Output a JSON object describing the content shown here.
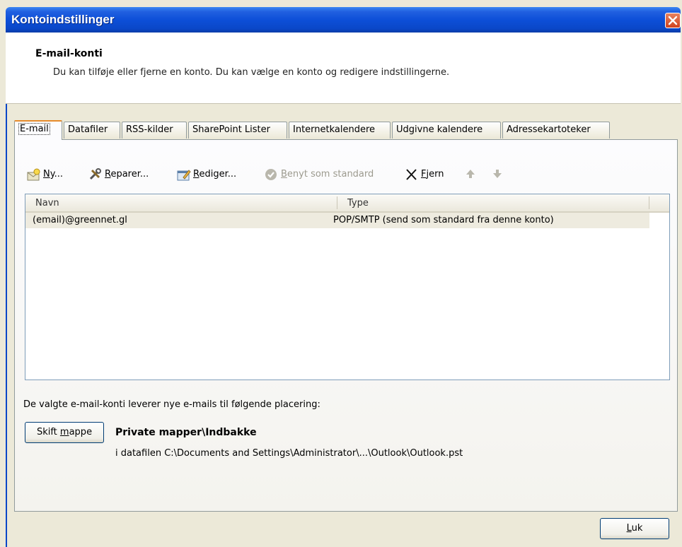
{
  "window": {
    "title": "Kontoindstillinger",
    "accent_color": "#0a47c8"
  },
  "header": {
    "title": "E-mail-konti",
    "subtitle": "Du kan tilføje eller fjerne en konto. Du kan vælge en konto og redigere indstillingerne."
  },
  "tabs": [
    {
      "label": "E-mail",
      "active": true
    },
    {
      "label": "Datafiler"
    },
    {
      "label": "RSS-kilder"
    },
    {
      "label": "SharePoint Lister"
    },
    {
      "label": "Internetkalendere"
    },
    {
      "label": "Udgivne kalendere"
    },
    {
      "label": "Adressekartoteker"
    }
  ],
  "toolbar": {
    "new": {
      "prefix": "",
      "key": "N",
      "rest": "y...",
      "icon": "new-account-icon"
    },
    "repair": {
      "prefix": "",
      "key": "R",
      "rest": "eparer...",
      "icon": "repair-tools-icon"
    },
    "edit": {
      "prefix": "",
      "key": "R",
      "rest": "ediger...",
      "icon": "edit-account-icon"
    },
    "set_default": {
      "prefix": "",
      "key": "B",
      "rest": "enyt som standard",
      "icon": "checkmark-icon",
      "disabled": true
    },
    "remove": {
      "prefix": "",
      "key": "F",
      "rest": "jern",
      "icon": "close-x-icon"
    },
    "move_up_icon": "arrow-up-icon",
    "move_down_icon": "arrow-down-icon"
  },
  "account_list": {
    "columns": [
      "Navn",
      "Type"
    ],
    "rows": [
      {
        "name": "(email)@greennet.gl",
        "type": "POP/SMTP (send som standard fra denne konto)"
      }
    ]
  },
  "delivery": {
    "description": "De valgte e-mail-konti leverer nye e-mails til følgende placering:",
    "change_folder_button": {
      "prefix": "Skift ",
      "key": "m",
      "rest": "appe"
    },
    "location_title": "Private mapper\\Indbakke",
    "location_path": "i datafilen C:\\Documents and Settings\\Administrator\\...\\Outlook\\Outlook.pst"
  },
  "footer": {
    "close_button": {
      "prefix": "",
      "key": "L",
      "rest": "uk"
    }
  }
}
